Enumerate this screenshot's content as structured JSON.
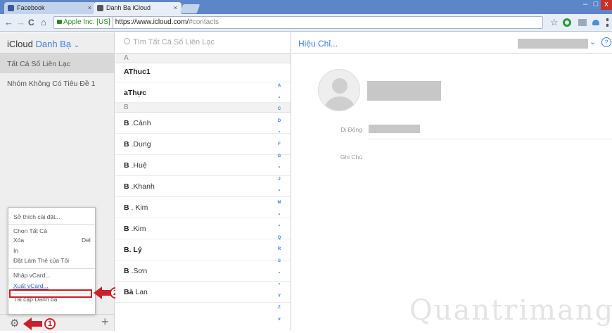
{
  "browser": {
    "tabs": [
      {
        "title": "Facebook",
        "close": "×",
        "fav_color": "#3b5998"
      },
      {
        "title": "Danh Bạ iCloud",
        "close": "×",
        "fav_color": "#555555"
      }
    ],
    "controls": {
      "minimize": "–",
      "maximize": "□",
      "close": "x"
    },
    "nav": {
      "back": "←",
      "forward": "→",
      "reload": "C",
      "home": "⌂"
    },
    "ev_label": "Apple Inc. [US]",
    "url_host": "https://www.icloud.com/",
    "url_path": "#contacts",
    "star": "☆"
  },
  "app": {
    "brand": "iCloud",
    "name": "Danh Bạ",
    "dropdown": "⌄",
    "groups": [
      {
        "label": "Tất Cả Số Liên Lạc",
        "selected": true
      },
      {
        "label": "Nhóm Không Có Tiêu Đề 1",
        "selected": false
      }
    ],
    "search_placeholder": "Tìm Tất Cả Số Liên Lạc",
    "section_a": "A",
    "section_b": "B",
    "contacts_a": [
      "AThuc1",
      "aThực"
    ],
    "contacts_b": [
      {
        "bold": "B",
        "rest": " .Cảnh"
      },
      {
        "bold": "B",
        "rest": " .Dung"
      },
      {
        "bold": "B",
        "rest": " .Huệ"
      },
      {
        "bold": "B",
        "rest": " .Khanh"
      },
      {
        "bold": "B",
        "rest": " . Kim"
      },
      {
        "bold": "B",
        "rest": " .Kim"
      },
      {
        "bold": "B. Lý",
        "rest": ""
      },
      {
        "bold": "B",
        "rest": " .Sơn"
      },
      {
        "bold": "Bà",
        "rest": " Lan"
      }
    ],
    "index": [
      "A",
      "•",
      "C",
      "D",
      "•",
      "F",
      "G",
      "•",
      "J",
      "•",
      "M",
      "•",
      "•",
      "Q",
      "R",
      "S",
      "•",
      "•",
      "Y",
      "Z",
      "#"
    ],
    "edit_label": "Hiệu Chỉ...",
    "help": "?",
    "field_mobile": "Di Động",
    "field_note": "Ghi Chú",
    "gear": "⚙",
    "plus": "+"
  },
  "menu": {
    "preferences": "Sở thích cài đặt...",
    "select_all": "Chọn Tất Cả",
    "delete": "Xóa",
    "delete_shortcut": "Del",
    "print": "In",
    "set_my_card": "Đặt Làm Thẻ của Tôi",
    "import": "Nhập vCard...",
    "export": "Xuất vCard...",
    "refresh": "Tải cập Danh bạ"
  },
  "annotations": {
    "step1": "1",
    "step2": "2",
    "accent": "#c8212a"
  },
  "watermark": "Quantrimang"
}
